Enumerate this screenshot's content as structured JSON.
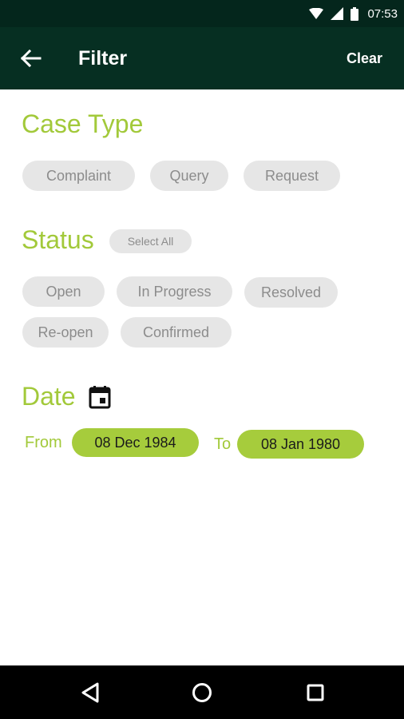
{
  "status_bar": {
    "time": "07:53",
    "icons": [
      "wifi-icon",
      "signal-icon",
      "battery-icon"
    ]
  },
  "app_bar": {
    "title": "Filter",
    "clear_label": "Clear",
    "back_icon": "arrow-left-icon"
  },
  "case_type": {
    "title": "Case Type",
    "options": [
      "Complaint",
      "Query",
      "Request"
    ]
  },
  "status": {
    "title": "Status",
    "select_all_label": "Select All",
    "options": [
      "Open",
      "In Progress",
      "Resolved",
      "Re-open",
      "Confirmed"
    ]
  },
  "date": {
    "title": "Date",
    "icon": "calendar-icon",
    "from_label": "From",
    "from_value": "08 Dec 1984",
    "to_label": "To",
    "to_value": "08 Jan 1980"
  },
  "nav_bar": {
    "icons": [
      "back-triangle-icon",
      "home-circle-icon",
      "recents-square-icon"
    ]
  },
  "colors": {
    "app_bar": "#062f22",
    "status_bar": "#04261c",
    "accent": "#a2c93a",
    "date_chip": "#a6cc3c",
    "chip_bg": "#e6e6e6",
    "chip_text": "#8c8c8c"
  }
}
